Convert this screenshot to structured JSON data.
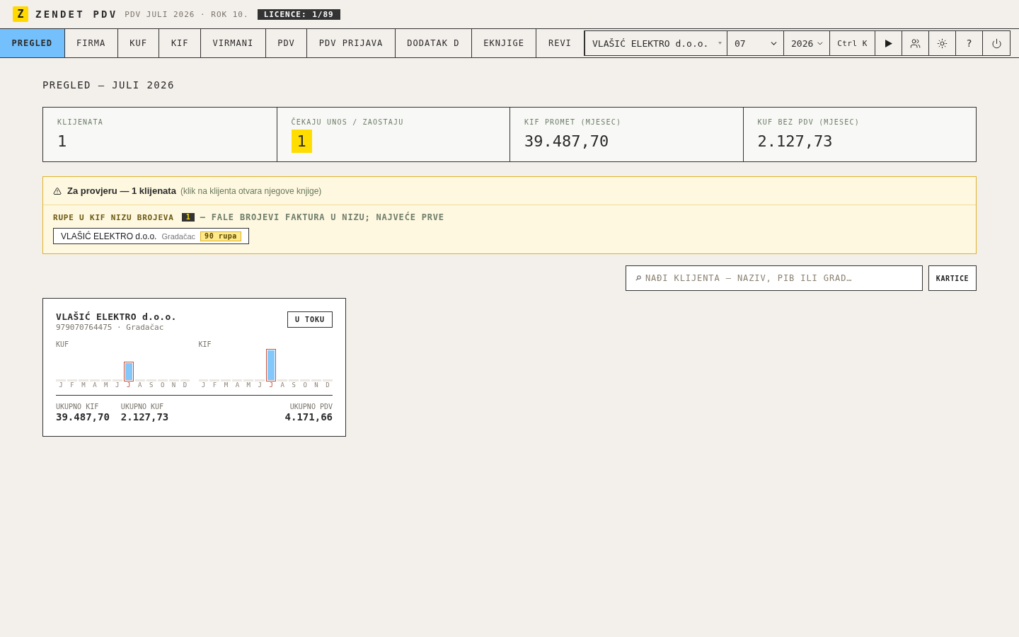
{
  "brand": {
    "logo_letter": "Z",
    "name": "ZENDET PDV",
    "subtitle": "PDV JULI 2026 · ROK 10.",
    "licence": "LICENCE: 1/89"
  },
  "tabs": [
    {
      "label": "PREGLED",
      "selected": true
    },
    {
      "label": "FIRMA",
      "selected": false
    },
    {
      "label": "KUF",
      "selected": false
    },
    {
      "label": "KIF",
      "selected": false
    },
    {
      "label": "VIRMANI",
      "selected": false
    },
    {
      "label": "PDV",
      "selected": false
    },
    {
      "label": "PDV PRIJAVA",
      "selected": false
    },
    {
      "label": "DODATAK D",
      "selected": false
    },
    {
      "label": "EKNJIGE",
      "selected": false
    },
    {
      "label": "REVI",
      "selected": false
    }
  ],
  "toolbar": {
    "client_select": {
      "value": "VLAŠIĆ ELEKTRO d.o.o."
    },
    "month_select": {
      "value": "07"
    },
    "year_select": {
      "value": "2026"
    },
    "shortcut": "Ctrl K",
    "buttons": [
      {
        "kind": "play"
      },
      {
        "kind": "users"
      },
      {
        "kind": "theme"
      },
      {
        "kind": "help",
        "label": "?"
      },
      {
        "kind": "power"
      }
    ]
  },
  "page_title": "PREGLED — JULI 2026",
  "stats": [
    {
      "label": "KLIJENATA",
      "value": "1",
      "highlight": false
    },
    {
      "label": "ČEKAJU UNOS / ZAOSTAJU",
      "value": "1",
      "highlight": true
    },
    {
      "label": "KIF PROMET (MJESEC)",
      "value": "39.487,70",
      "highlight": false
    },
    {
      "label": "KUF BEZ PDV (MJESEC)",
      "value": "2.127,73",
      "highlight": false
    }
  ],
  "alert": {
    "title": "Za provjeru — 1 klijenata",
    "note": "(klik na klijenta otvara njegove knjige)",
    "sections": [
      {
        "title": "RUPE U KIF NIZU BROJEVA",
        "count": "1",
        "description": "— FALE BROJEVI FAKTURA U NIZU; NAJVEĆE PRVE",
        "clients": [
          {
            "name": "VLAŠIĆ ELEKTRO d.o.o.",
            "city": "Gradačac",
            "badge": "90 rupa"
          }
        ]
      }
    ]
  },
  "search": {
    "placeholder": "NAĐI KLIJENTA — NAZIV, PIB ILI GRAD…"
  },
  "view_button": "KARTICE",
  "clients": [
    {
      "name": "VLAŠIĆ ELEKTRO d.o.o.",
      "meta": "979070764475 · Gradačac",
      "status": "U TOKU",
      "charts": [
        {
          "label": "KUF",
          "months": [
            {
              "label": "J",
              "selected": false
            },
            {
              "label": "F",
              "selected": false
            },
            {
              "label": "M",
              "selected": false
            },
            {
              "label": "A",
              "selected": false
            },
            {
              "label": "M",
              "selected": false
            },
            {
              "label": "J",
              "selected": false
            },
            {
              "label": "J",
              "selected": true,
              "level": 0.6
            },
            {
              "label": "A",
              "selected": false
            },
            {
              "label": "S",
              "selected": false
            },
            {
              "label": "O",
              "selected": false
            },
            {
              "label": "N",
              "selected": false
            },
            {
              "label": "D",
              "selected": false
            }
          ]
        },
        {
          "label": "KIF",
          "months": [
            {
              "label": "J",
              "selected": false
            },
            {
              "label": "F",
              "selected": false
            },
            {
              "label": "M",
              "selected": false
            },
            {
              "label": "A",
              "selected": false
            },
            {
              "label": "M",
              "selected": false
            },
            {
              "label": "J",
              "selected": false
            },
            {
              "label": "J",
              "selected": true,
              "level": 1
            },
            {
              "label": "A",
              "selected": false
            },
            {
              "label": "S",
              "selected": false
            },
            {
              "label": "O",
              "selected": false
            },
            {
              "label": "N",
              "selected": false
            },
            {
              "label": "D",
              "selected": false
            }
          ]
        }
      ],
      "totals": [
        {
          "label": "UKUPNO KIF",
          "value": "39.487,70"
        },
        {
          "label": "UKUPNO KUF",
          "value": "2.127,73"
        },
        {
          "label": "UKUPNO PDV",
          "value": "4.171,66"
        }
      ]
    }
  ]
}
